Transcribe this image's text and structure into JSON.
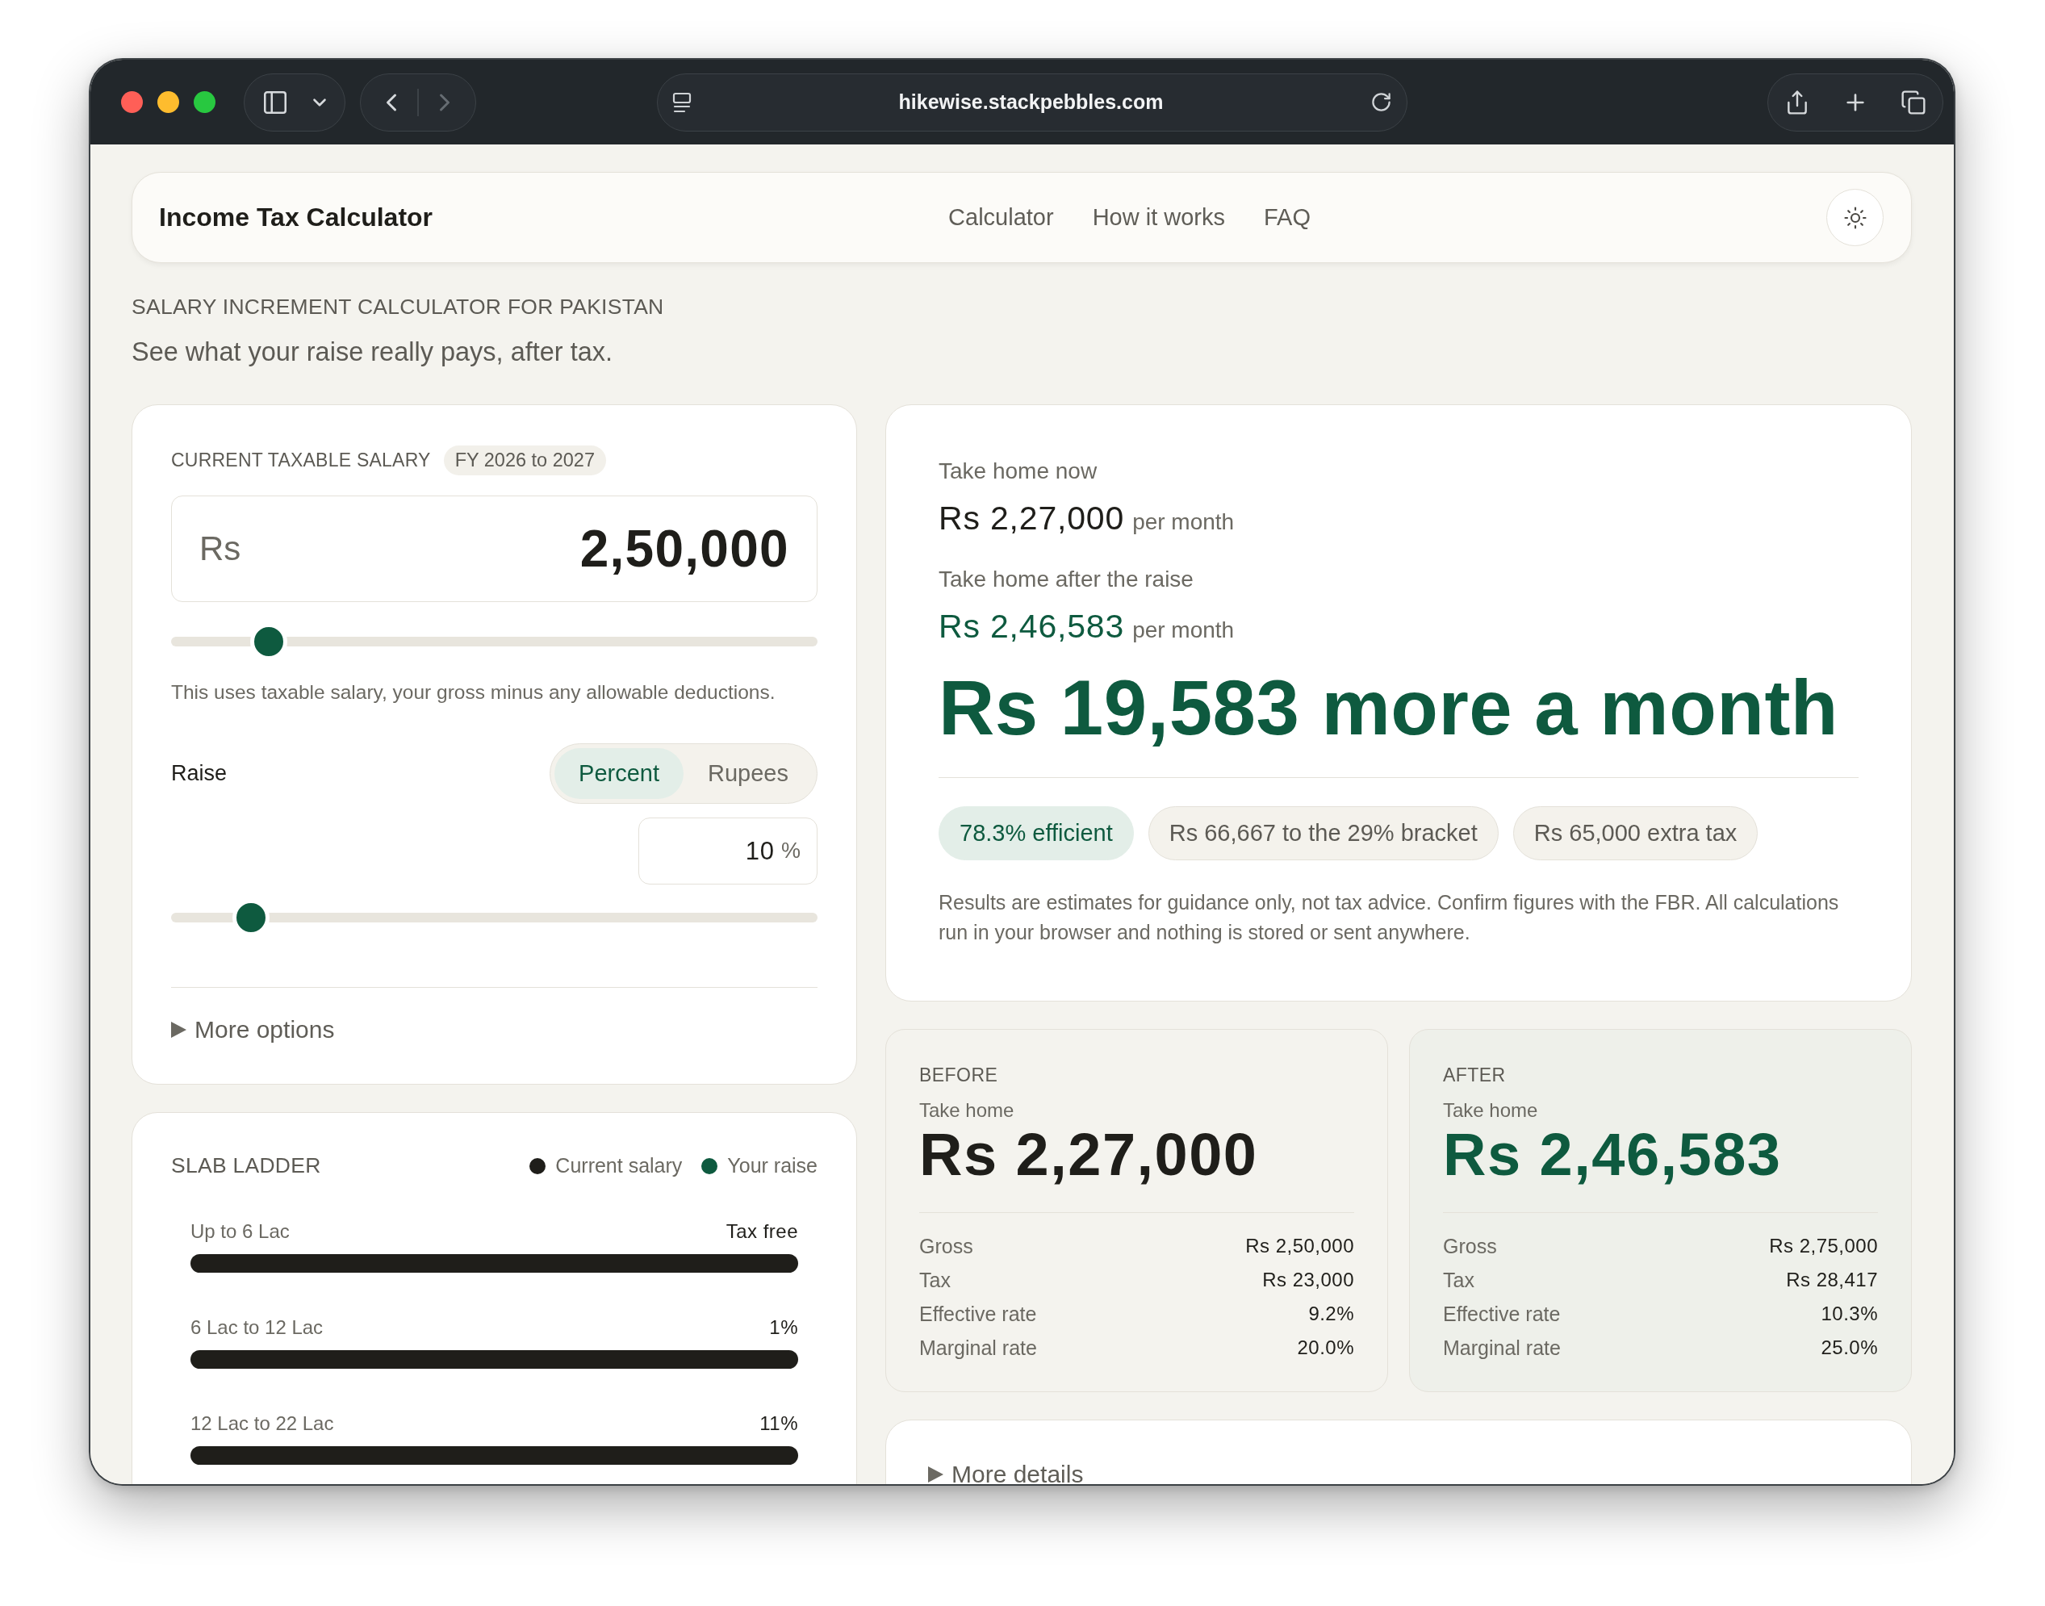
{
  "browser": {
    "url": "hikewise.stackpebbles.com",
    "nav_buttons": [
      {
        "kind": "back",
        "disabled": false
      },
      {
        "kind": "forward",
        "disabled": true
      }
    ]
  },
  "header": {
    "title": "Income Tax Calculator",
    "nav": [
      "Calculator",
      "How it works",
      "FAQ"
    ]
  },
  "intro": {
    "kicker": "SALARY INCREMENT CALCULATOR FOR PAKISTAN",
    "tagline": "See what your raise really pays, after tax."
  },
  "salary_card": {
    "label": "CURRENT TAXABLE SALARY",
    "badge": "FY 2026 to 2027",
    "currency": "Rs",
    "value": "2,50,000",
    "slider": {
      "level": 0.13
    },
    "hint": "This uses taxable salary, your gross minus any allowable deductions.",
    "raise": {
      "label": "Raise",
      "modes": [
        {
          "label": "Percent",
          "selected": true
        },
        {
          "label": "Rupees",
          "selected": false
        }
      ],
      "value": "10",
      "unit": "%",
      "slider": {
        "level": 0.1
      }
    },
    "more_options": {
      "label": "More options",
      "expanded": false
    }
  },
  "slab_ladder": {
    "title": "SLAB LADDER",
    "legend": [
      {
        "label": "Current salary",
        "color": "#1f1e1a"
      },
      {
        "label": "Your raise",
        "color": "#0e5a3f"
      }
    ],
    "slabs": [
      {
        "label": "Up to 6 Lac",
        "rate": "Tax free"
      },
      {
        "label": "6 Lac to 12 Lac",
        "rate": "1%"
      },
      {
        "label": "12 Lac to 22 Lac",
        "rate": "11%"
      }
    ]
  },
  "result": {
    "now_label": "Take home now",
    "now_value": "Rs 2,27,000",
    "now_unit": "per month",
    "after_label": "Take home after the raise",
    "after_value": "Rs 2,46,583",
    "after_unit": "per month",
    "headline": "Rs 19,583 more a month",
    "pills": [
      {
        "label": "78.3% efficient",
        "kind": "highlight"
      },
      {
        "label": "Rs 66,667 to the 29% bracket",
        "kind": "plain"
      },
      {
        "label": "Rs 65,000 extra tax",
        "kind": "plain"
      }
    ],
    "disclaimer": "Results are estimates for guidance only, not tax advice. Confirm figures with the FBR. All calculations run in your browser and nothing is stored or sent anywhere."
  },
  "comparison": [
    {
      "kind": "before",
      "title": "BEFORE",
      "label": "Take home",
      "value": "Rs 2,27,000",
      "rows": [
        {
          "label": "Gross",
          "value": "Rs 2,50,000"
        },
        {
          "label": "Tax",
          "value": "Rs 23,000"
        },
        {
          "label": "Effective rate",
          "value": "9.2%"
        },
        {
          "label": "Marginal rate",
          "value": "20.0%"
        }
      ]
    },
    {
      "kind": "after",
      "title": "AFTER",
      "label": "Take home",
      "value": "Rs 2,46,583",
      "rows": [
        {
          "label": "Gross",
          "value": "Rs 2,75,000"
        },
        {
          "label": "Tax",
          "value": "Rs 28,417"
        },
        {
          "label": "Effective rate",
          "value": "10.3%"
        },
        {
          "label": "Marginal rate",
          "value": "25.0%"
        }
      ]
    }
  ],
  "more_details": {
    "label": "More details",
    "expanded": false
  }
}
